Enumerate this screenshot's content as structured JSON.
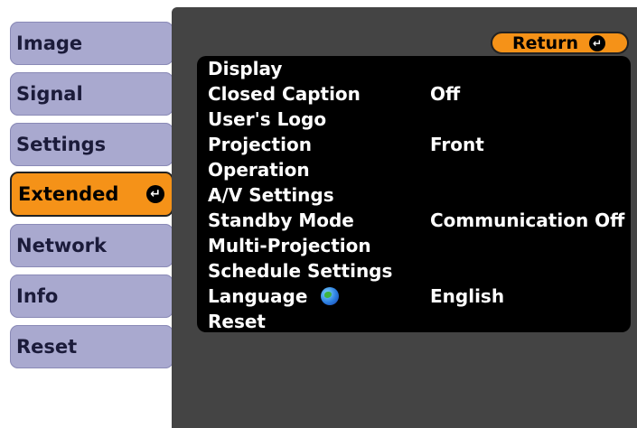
{
  "tabs": [
    {
      "label": "Image",
      "active": false
    },
    {
      "label": "Signal",
      "active": false
    },
    {
      "label": "Settings",
      "active": false
    },
    {
      "label": "Extended",
      "active": true,
      "icon": "enter-icon"
    },
    {
      "label": "Network",
      "active": false
    },
    {
      "label": "Info",
      "active": false
    },
    {
      "label": "Reset",
      "active": false
    }
  ],
  "return_button": {
    "label": "Return",
    "icon": "enter-icon"
  },
  "menu": [
    {
      "label": "Display",
      "value": ""
    },
    {
      "label": "Closed Caption",
      "value": "Off"
    },
    {
      "label": "User's Logo",
      "value": ""
    },
    {
      "label": "Projection",
      "value": "Front"
    },
    {
      "label": "Operation",
      "value": ""
    },
    {
      "label": "A/V Settings",
      "value": ""
    },
    {
      "label": "Standby Mode",
      "value": "Communication Off"
    },
    {
      "label": "Multi-Projection",
      "value": ""
    },
    {
      "label": "Schedule Settings",
      "value": ""
    },
    {
      "label": "Language",
      "value": "English",
      "icon": "globe-icon"
    },
    {
      "label": "Reset",
      "value": ""
    }
  ],
  "colors": {
    "tab_inactive": "#a9a9cf",
    "tab_active": "#f59218",
    "panel_bg": "#444444",
    "menu_bg": "#000000",
    "text_light": "#ffffff"
  }
}
